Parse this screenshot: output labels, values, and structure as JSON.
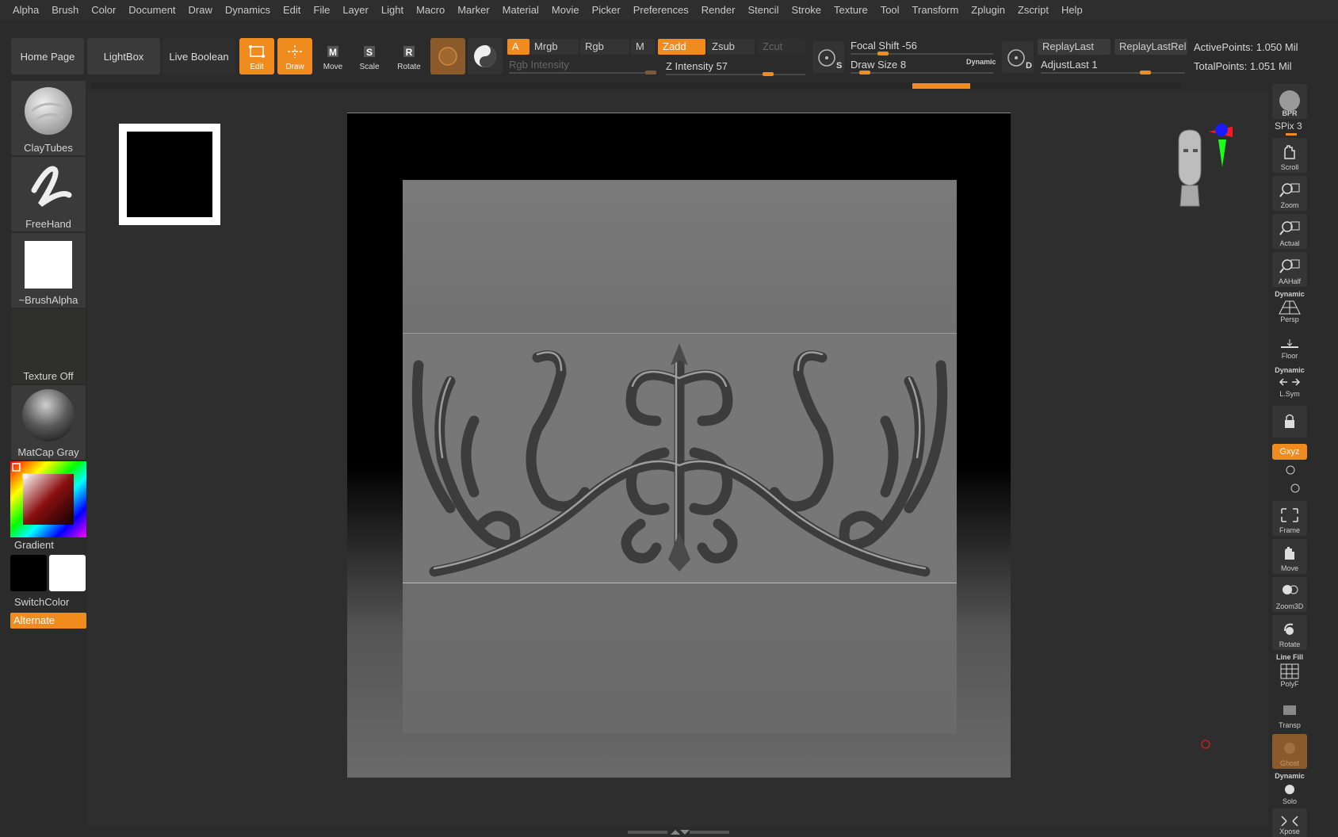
{
  "menu": [
    "Alpha",
    "Brush",
    "Color",
    "Document",
    "Draw",
    "Dynamics",
    "Edit",
    "File",
    "Layer",
    "Light",
    "Macro",
    "Marker",
    "Material",
    "Movie",
    "Picker",
    "Preferences",
    "Render",
    "Stencil",
    "Stroke",
    "Texture",
    "Tool",
    "Transform",
    "Zplugin",
    "Zscript",
    "Help"
  ],
  "toolbar": {
    "home_page": "Home Page",
    "lightbox": "LightBox",
    "live_boolean": "Live Boolean",
    "edit": "Edit",
    "draw": "Draw",
    "move": "Move",
    "scale": "Scale",
    "rotate": "Rotate",
    "a": "A",
    "mrgb": "Mrgb",
    "rgb": "Rgb",
    "m": "M",
    "zadd": "Zadd",
    "zsub": "Zsub",
    "zcut": "Zcut",
    "rgb_intensity": "Rgb Intensity",
    "z_intensity": "Z Intensity 57",
    "focal_shift": "Focal Shift -56",
    "draw_size": "Draw Size 8",
    "dynamic": "Dynamic",
    "replay_last": "ReplayLast",
    "replay_last_rel": "ReplayLastRel",
    "adjust_last": "AdjustLast 1",
    "active_points": "ActivePoints: 1.050 Mil",
    "total_points": "TotalPoints: 1.051 Mil",
    "s_icon_letter": "S",
    "d_icon_letter": "D"
  },
  "left": {
    "brush": "ClayTubes",
    "stroke": "FreeHand",
    "alpha": "~BrushAlpha",
    "texture": "Texture Off",
    "material": "MatCap Gray",
    "gradient": "Gradient",
    "switch_color": "SwitchColor",
    "alternate": "Alternate"
  },
  "right": {
    "bpr": "BPR",
    "spix": "SPix 3",
    "scroll": "Scroll",
    "zoom": "Zoom",
    "actual": "Actual",
    "aahalf": "AAHalf",
    "dynamic": "Dynamic",
    "persp": "Persp",
    "floor": "Floor",
    "lsym": "L.Sym",
    "xyz": "Gxyz",
    "frame": "Frame",
    "move": "Move",
    "zoom3d": "Zoom3D",
    "rotate": "Rotate",
    "line_fill": "Line Fill",
    "polyf": "PolyF",
    "transp": "Transp",
    "ghost": "Ghost",
    "solo": "Solo",
    "xpose": "Xpose"
  },
  "colors": {
    "accent": "#f08c1e",
    "background": "#2b2b2b"
  }
}
